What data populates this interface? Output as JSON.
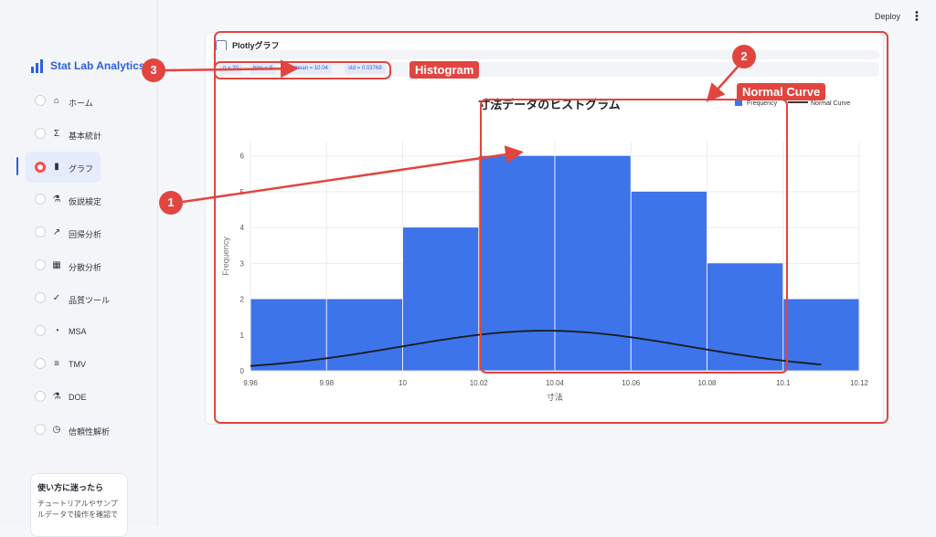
{
  "sidebar": {
    "brand": "Stat Lab Analytics",
    "items": [
      {
        "label": "ホーム",
        "icon": "home-icon"
      },
      {
        "label": "基本統計",
        "icon": "sigma-icon"
      },
      {
        "label": "グラフ",
        "icon": "bar-chart-icon",
        "active": true
      },
      {
        "label": "仮説検定",
        "icon": "flask-icon"
      },
      {
        "label": "回帰分析",
        "icon": "trend-icon"
      },
      {
        "label": "分散分析",
        "icon": "grid-icon"
      },
      {
        "label": "品質ツール",
        "icon": "check-circle-icon"
      },
      {
        "label": "MSA",
        "icon": "gauge-icon"
      },
      {
        "label": "TMV",
        "icon": "sliders-icon"
      },
      {
        "label": "DOE",
        "icon": "beaker-icon"
      },
      {
        "label": "信頼性解析",
        "icon": "clock-icon"
      }
    ],
    "help": {
      "title": "使い方に迷ったら",
      "body": "チュートリアルやサンプルデータで操作を確認で"
    }
  },
  "header": {
    "deploy": "Deploy",
    "menu_icon": "kebab-icon"
  },
  "panel": {
    "title": "Plotlyグラフ",
    "metrics": [
      "n = 20",
      "bins = 8",
      "mean = 10.04",
      "std = 0.03769"
    ]
  },
  "annotations": {
    "badge1": "1",
    "badge2": "2",
    "badge3": "3",
    "label_histogram": "Histogram",
    "label_normal_curve": "Normal Curve",
    "color": "#e2453f"
  },
  "chart_data": {
    "type": "bar",
    "title": "寸法データのヒストグラム",
    "xlabel": "寸法",
    "ylabel": "Frequency",
    "bins": [
      {
        "x0": 9.96,
        "x1": 9.98,
        "value": 2
      },
      {
        "x0": 9.98,
        "x1": 10.0,
        "value": 2
      },
      {
        "x0": 10.0,
        "x1": 10.02,
        "value": 4
      },
      {
        "x0": 10.02,
        "x1": 10.04,
        "value": 6
      },
      {
        "x0": 10.04,
        "x1": 10.06,
        "value": 6
      },
      {
        "x0": 10.06,
        "x1": 10.08,
        "value": 5
      },
      {
        "x0": 10.08,
        "x1": 10.1,
        "value": 3
      },
      {
        "x0": 10.1,
        "x1": 10.12,
        "value": 2
      }
    ],
    "series": [
      {
        "name": "Frequency",
        "color": "#3d74ea"
      },
      {
        "name": "Normal Curve",
        "color": "#1a1a1a",
        "mean": 10.0375,
        "std": 0.03769,
        "scale": 1.51,
        "x_range": [
          9.96,
          10.11
        ]
      }
    ],
    "xticks": [
      "9.96",
      "9.98",
      "10",
      "10.02",
      "10.04",
      "10.06",
      "10.08",
      "10.1",
      "10.12"
    ],
    "yticks": [
      "0",
      "1",
      "2",
      "3",
      "4",
      "5",
      "6"
    ],
    "xlim": [
      9.96,
      10.12
    ],
    "ylim": [
      0,
      6.4
    ],
    "grid": true,
    "legend": "top-right"
  }
}
